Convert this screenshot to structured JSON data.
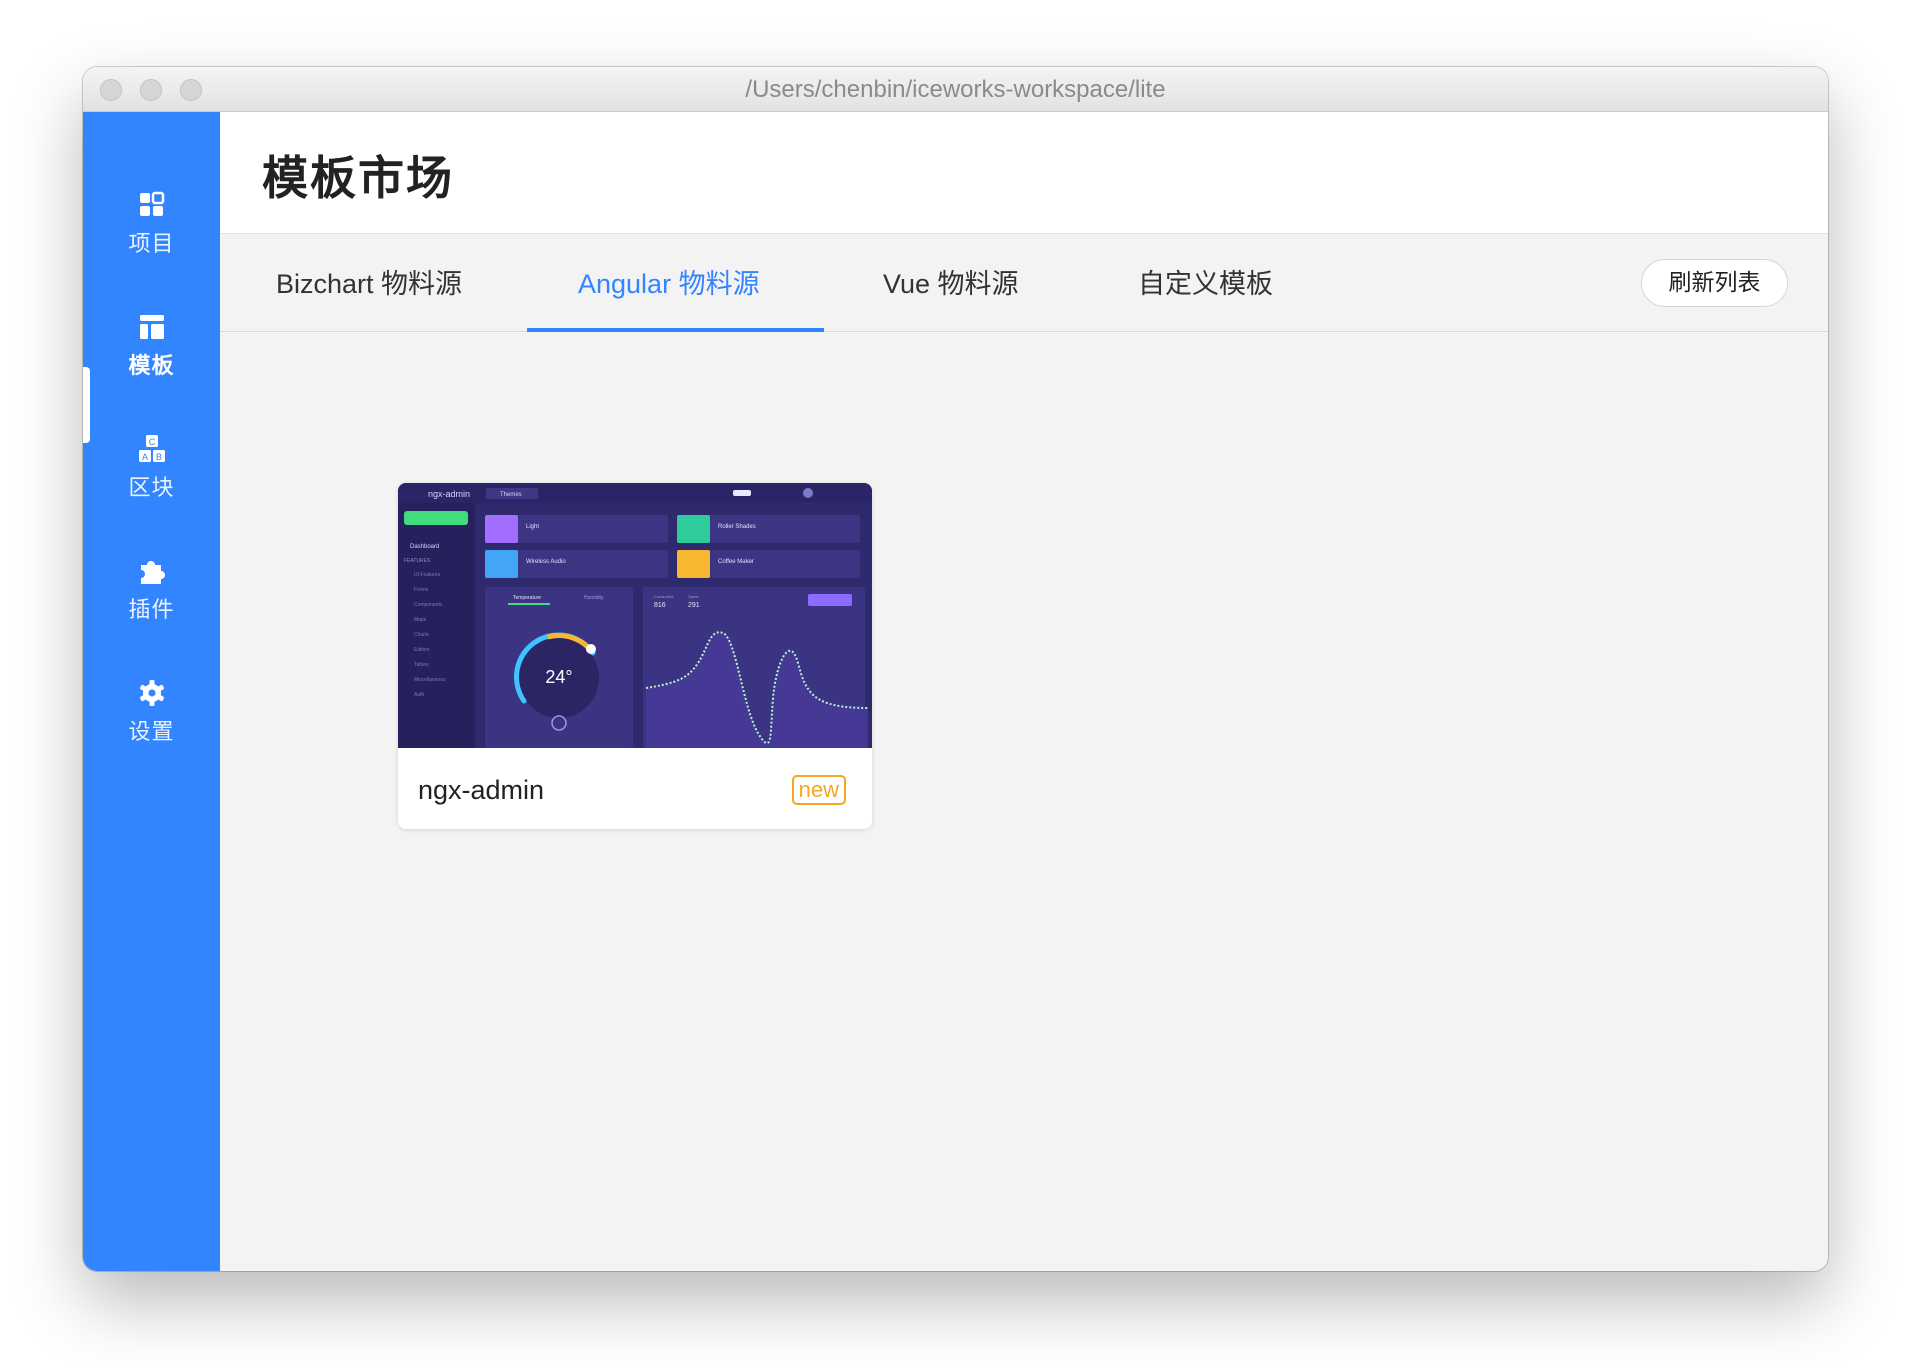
{
  "window": {
    "title": "/Users/chenbin/iceworks-workspace/lite"
  },
  "sidebar": {
    "items": [
      {
        "label": "项目",
        "icon": "grid-icon"
      },
      {
        "label": "模板",
        "icon": "layout-icon"
      },
      {
        "label": "区块",
        "icon": "blocks-icon"
      },
      {
        "label": "插件",
        "icon": "puzzle-icon"
      },
      {
        "label": "设置",
        "icon": "gear-icon"
      }
    ],
    "active_index": 1
  },
  "header": {
    "title": "模板市场"
  },
  "tabs": {
    "items": [
      "Bizchart 物料源",
      "Angular 物料源",
      "Vue 物料源",
      "自定义模板"
    ],
    "active_index": 1,
    "refresh_label": "刷新列表"
  },
  "templates": [
    {
      "name": "ngx-admin",
      "badge": "new",
      "preview": {
        "brand": "ngx-admin",
        "theme_label": "Themes",
        "menu_first": "Dashboard",
        "menu_section": "FEATURES",
        "menu_items": [
          "UI Features",
          "Forms",
          "Components",
          "Maps",
          "Charts",
          "Editors",
          "Tables",
          "Miscellaneous",
          "Auth"
        ],
        "devices": [
          "Light",
          "Roller Shades",
          "Wireless Audio",
          "Coffee Maker"
        ],
        "tabs": [
          "Temperature",
          "Humidity"
        ],
        "dial_value": "24°",
        "stats": [
          {
            "label": "Consumed",
            "value": "816"
          },
          {
            "label": "Spent",
            "value": "291"
          }
        ]
      }
    }
  ],
  "colors": {
    "sidebar": "#3385ff",
    "accent": "#3385ff",
    "badge": "#f5a623",
    "preview_bg": "#2f2a6e"
  }
}
